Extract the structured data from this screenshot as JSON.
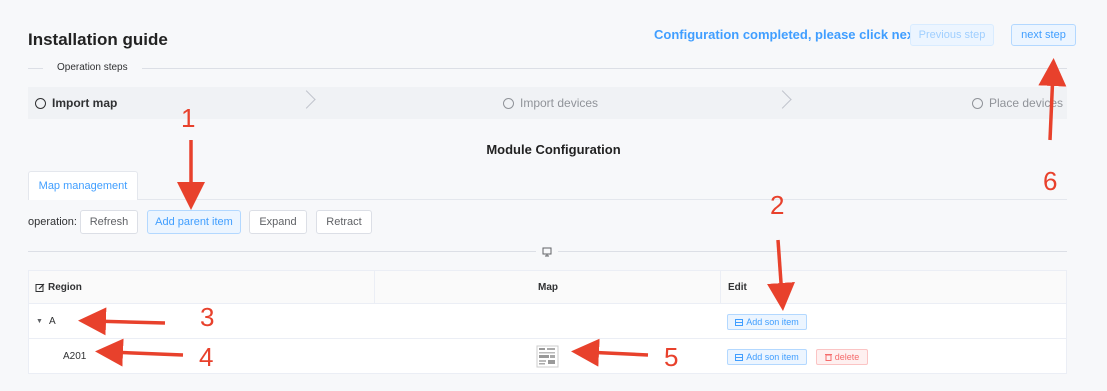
{
  "header": {
    "title": "Installation guide",
    "status": "Configuration completed, please click next",
    "prev_label": "Previous step",
    "next_label": "next step"
  },
  "steps": {
    "divider_label": "Operation steps",
    "items": [
      {
        "label": "Import map",
        "active": true
      },
      {
        "label": "Import devices",
        "active": false
      },
      {
        "label": "Place devices",
        "active": false
      }
    ]
  },
  "module": {
    "title": "Module Configuration",
    "tab_label": "Map management"
  },
  "operation": {
    "label": "operation:",
    "buttons": [
      "Refresh",
      "Add parent item",
      "Expand",
      "Retract"
    ]
  },
  "table": {
    "columns": [
      "Region",
      "Map",
      "Edit"
    ],
    "rows": [
      {
        "region": "A",
        "has_map": false,
        "actions": [
          "Add son item"
        ]
      },
      {
        "region": "A201",
        "has_map": true,
        "actions": [
          "Add son item",
          "delete"
        ]
      }
    ]
  },
  "annotations": [
    "1",
    "2",
    "3",
    "4",
    "5",
    "6"
  ],
  "colors": {
    "accent": "#409eff",
    "danger": "#f56c6c",
    "annotation": "#e8412c"
  },
  "icons": {
    "region_header": "edit-icon",
    "divider": "monitor-icon",
    "son": "table-icon",
    "delete": "trash-icon",
    "expand": "caret-down-icon"
  }
}
